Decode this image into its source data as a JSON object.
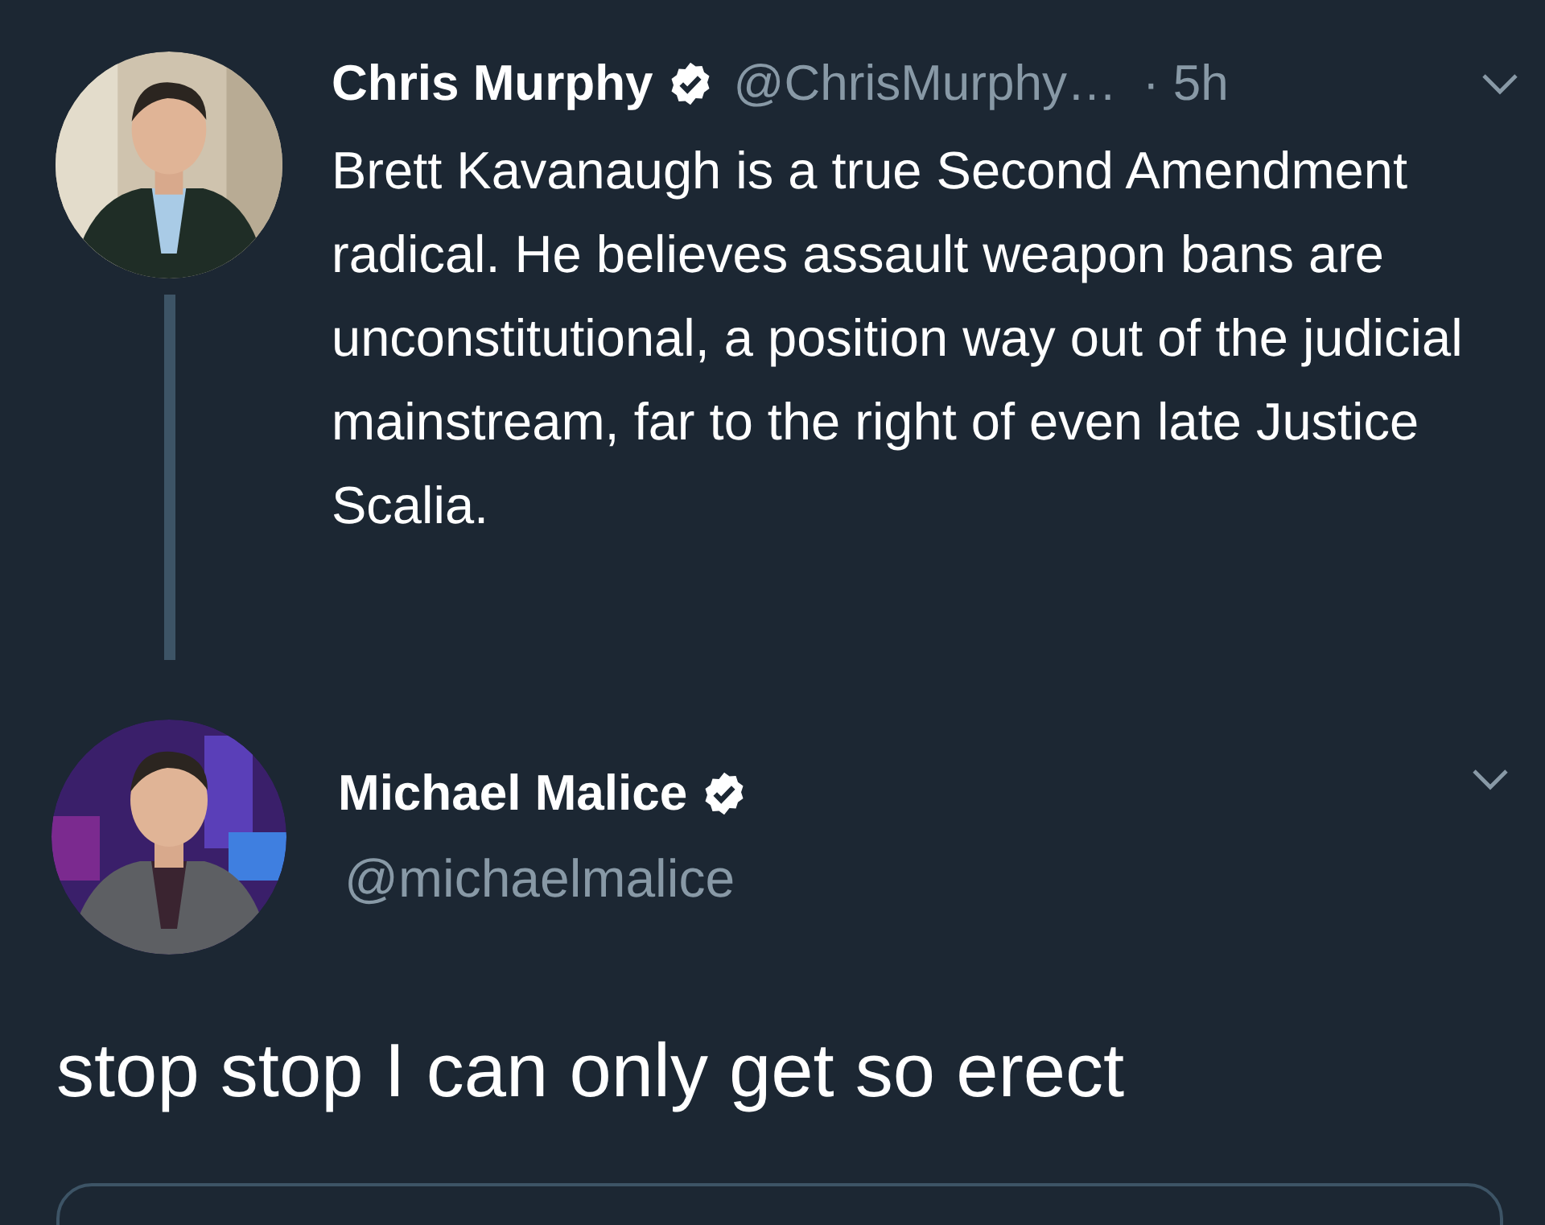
{
  "tweets": [
    {
      "kind": "thread",
      "name": "Chris Murphy",
      "verified": true,
      "handle": "@ChrisMurphy…",
      "time": "· 5h",
      "text": "Brett Kavanaugh is a true Second Amendment radical. He believes assault weapon bans are unconstitutional, a position way out of the judicial mainstream, far to the right of even late Justice Scalia."
    },
    {
      "kind": "focused",
      "name": "Michael Malice",
      "verified": true,
      "handle": "@michaelmalice",
      "text": "stop stop I can only get so erect",
      "quoted_card": true
    }
  ]
}
